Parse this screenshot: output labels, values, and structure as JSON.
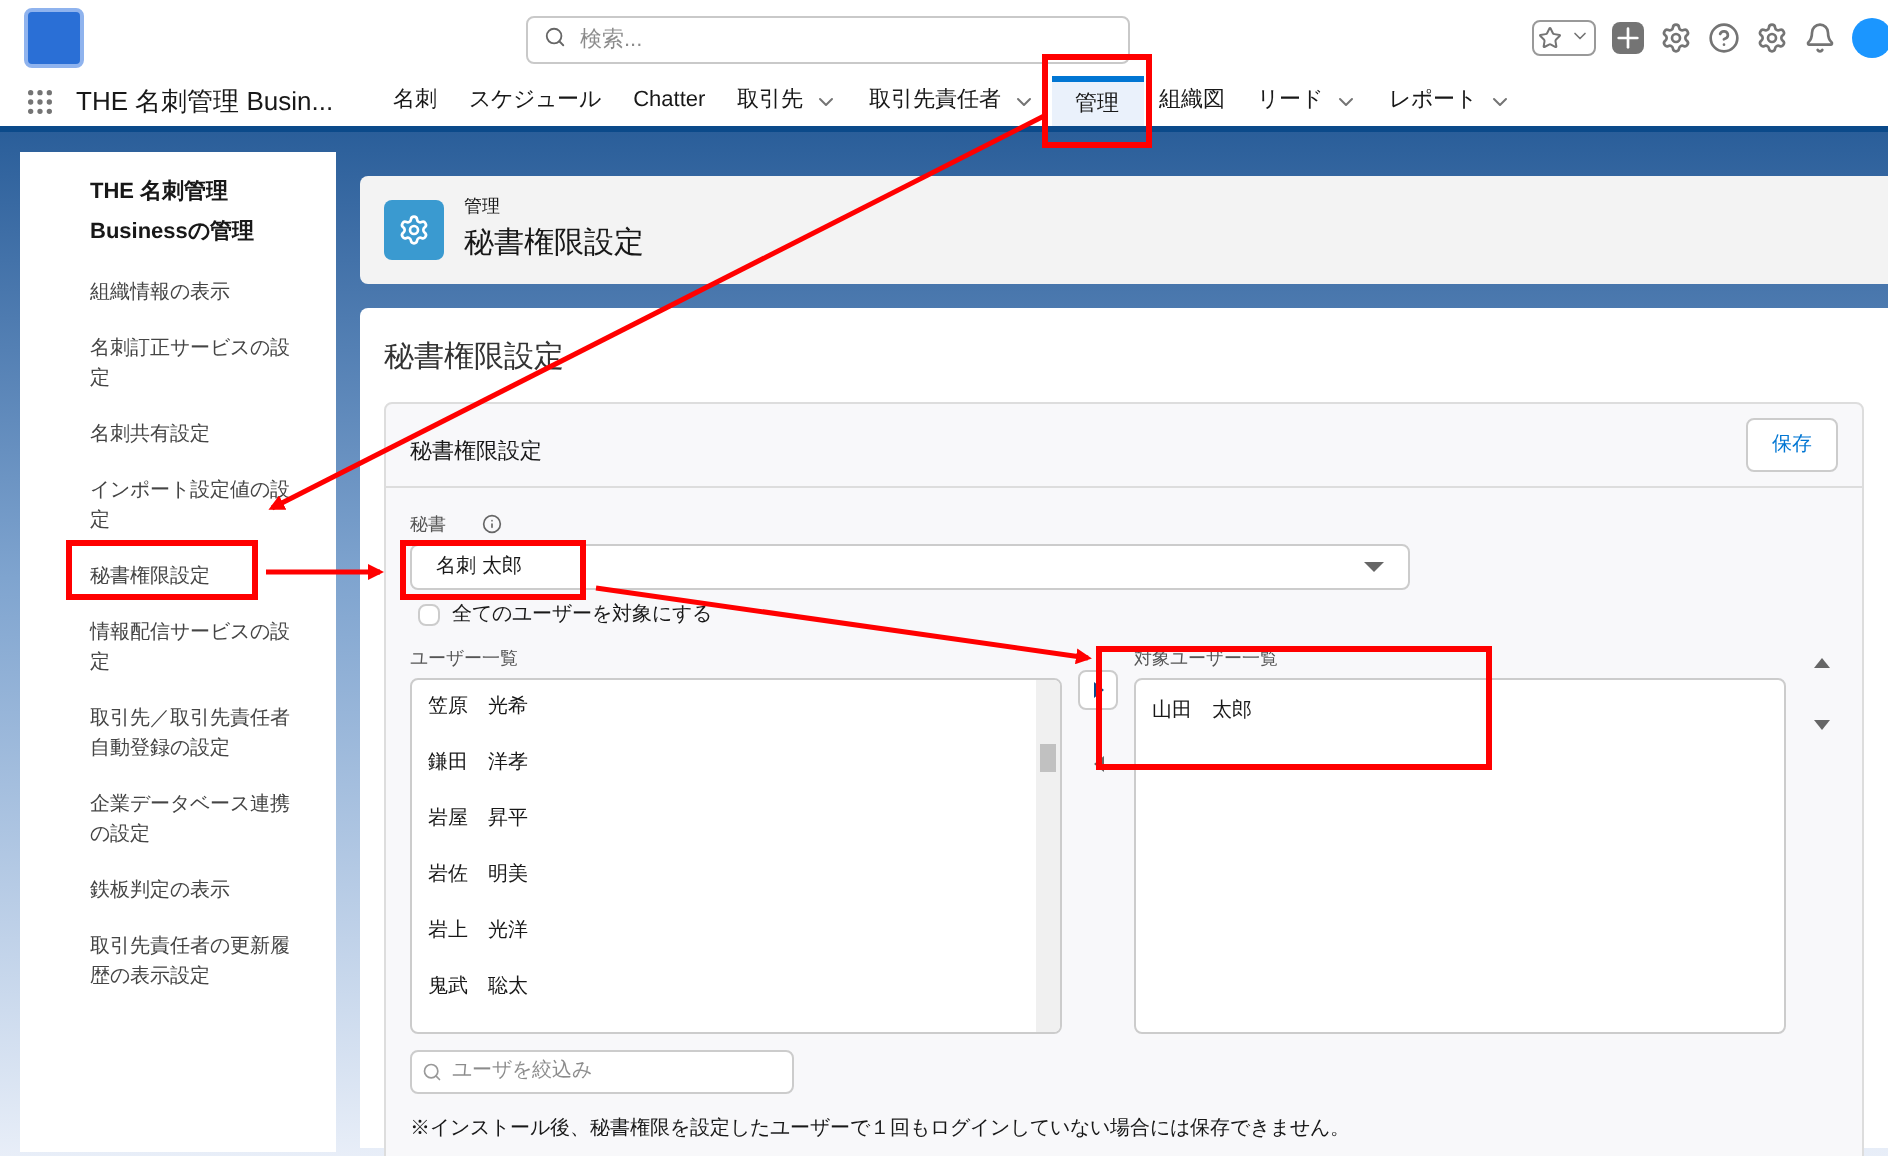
{
  "header": {
    "search": {
      "placeholder": "検索..."
    }
  },
  "nav": {
    "app_name": "THE 名刺管理 Busin...",
    "items": [
      {
        "label": "名刺",
        "dropdown": false,
        "selected": false
      },
      {
        "label": "スケジュール",
        "dropdown": false,
        "selected": false
      },
      {
        "label": "Chatter",
        "dropdown": false,
        "selected": false
      },
      {
        "label": "取引先",
        "dropdown": true,
        "selected": false
      },
      {
        "label": "取引先責任者",
        "dropdown": true,
        "selected": false
      },
      {
        "label": "管理",
        "dropdown": false,
        "selected": true
      },
      {
        "label": "組織図",
        "dropdown": false,
        "selected": false
      },
      {
        "label": "リード",
        "dropdown": true,
        "selected": false
      },
      {
        "label": "レポート",
        "dropdown": true,
        "selected": false
      }
    ]
  },
  "sidebar": {
    "title": "THE 名刺管理 Businessの管理",
    "items": [
      {
        "label": "組織情報の表示"
      },
      {
        "label": "名刺訂正サービスの設定"
      },
      {
        "label": "名刺共有設定"
      },
      {
        "label": "インポート設定値の設定"
      },
      {
        "label": "秘書権限設定"
      },
      {
        "label": "情報配信サービスの設定"
      },
      {
        "label": "取引先／取引先責任者自動登録の設定"
      },
      {
        "label": "企業データベース連携の設定"
      },
      {
        "label": "鉄板判定の表示"
      },
      {
        "label": "取引先責任者の更新履歴の表示設定"
      }
    ]
  },
  "page_header": {
    "breadcrumb": "管理",
    "title": "秘書権限設定"
  },
  "main": {
    "title": "秘書権限設定",
    "section_title": "秘書権限設定",
    "save_button": "保存",
    "secretary_label": "秘書",
    "secretary_value": "名刺 太郎",
    "all_users": {
      "label": "全てのユーザーを対象にする",
      "checked": false
    },
    "user_list": {
      "label": "ユーザー一覧",
      "items": [
        "笠原　光希",
        "鎌田　洋孝",
        "岩屋　昇平",
        "岩佐　明美",
        "岩上　光洋",
        "鬼武　聡太"
      ]
    },
    "target_list": {
      "label": "対象ユーザー一覧",
      "items": [
        "山田　太郎"
      ]
    },
    "filter": {
      "placeholder": "ユーザを絞込み"
    },
    "note": "※インストール後、秘書権限を設定したユーザーで１回もログインしていない場合には保存できません。"
  }
}
